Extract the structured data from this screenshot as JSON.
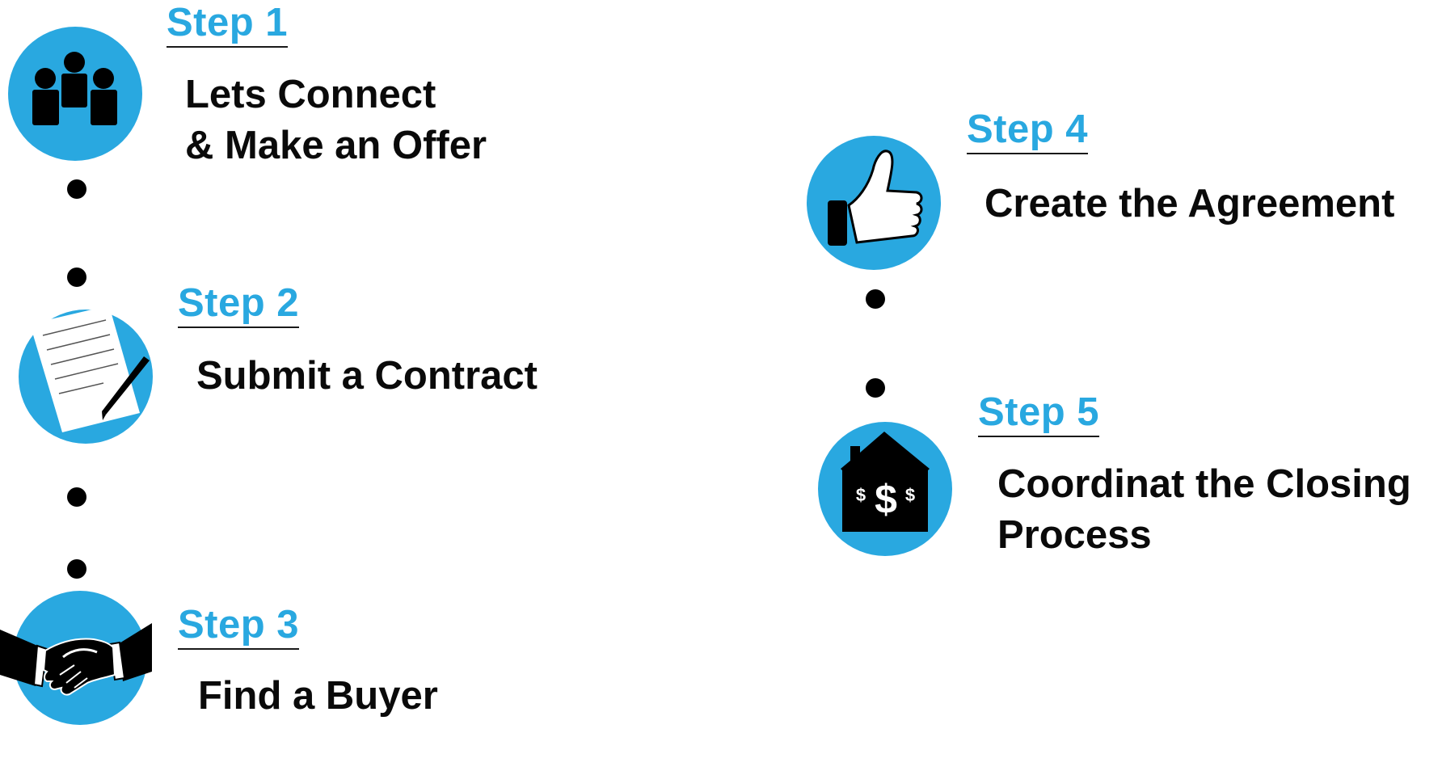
{
  "colors": {
    "accent": "#29a8e0",
    "text": "#0a0a0a",
    "icon": "#000000"
  },
  "steps": [
    {
      "label": "Step 1",
      "text": "Lets Connect\n& Make an Offer",
      "icon": "people-icon"
    },
    {
      "label": "Step 2",
      "text": "Submit a Contract",
      "icon": "contract-icon"
    },
    {
      "label": "Step 3",
      "text": "Find a Buyer",
      "icon": "handshake-icon"
    },
    {
      "label": "Step 4",
      "text": "Create the Agreement",
      "icon": "thumbs-up-icon"
    },
    {
      "label": "Step 5",
      "text": "Coordinat the Closing\nProcess",
      "icon": "house-money-icon"
    }
  ]
}
